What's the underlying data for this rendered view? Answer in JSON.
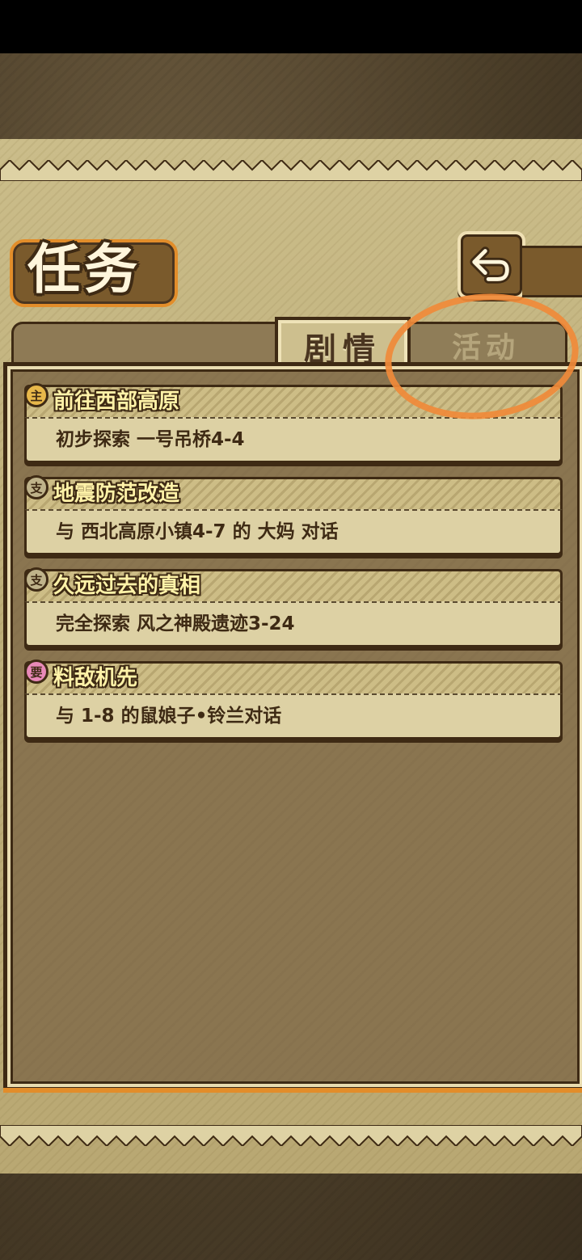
{
  "screen": {
    "title": "任务"
  },
  "tabs": [
    {
      "label": "剧情",
      "active": true
    },
    {
      "label": "活动",
      "active": false
    }
  ],
  "quests": [
    {
      "type_icon": "main-quest-icon",
      "icon_glyph": "主",
      "icon_color": "#e8b84a",
      "title": "前往西部高原",
      "description": "初步探索 一号吊桥4-4"
    },
    {
      "type_icon": "side-quest-icon",
      "icon_glyph": "支",
      "icon_color": "#bfb38a",
      "title": "地震防范改造",
      "description": "与 西北高原小镇4-7 的 大妈 对话"
    },
    {
      "type_icon": "side-quest-icon",
      "icon_glyph": "支",
      "icon_color": "#bfb38a",
      "title": "久远过去的真相",
      "description": "完全探索 风之神殿遗迹3-24"
    },
    {
      "type_icon": "special-quest-icon",
      "icon_glyph": "要",
      "icon_color": "#e889b8",
      "title": "料敌机先",
      "description": "与 1-8 的鼠娘子•铃兰对话"
    }
  ],
  "colors": {
    "accent_orange": "#e28d2a",
    "panel_brown": "#8a7550",
    "annotation": "#f08a3a"
  },
  "icons": {
    "back": "back-arrow-icon"
  }
}
